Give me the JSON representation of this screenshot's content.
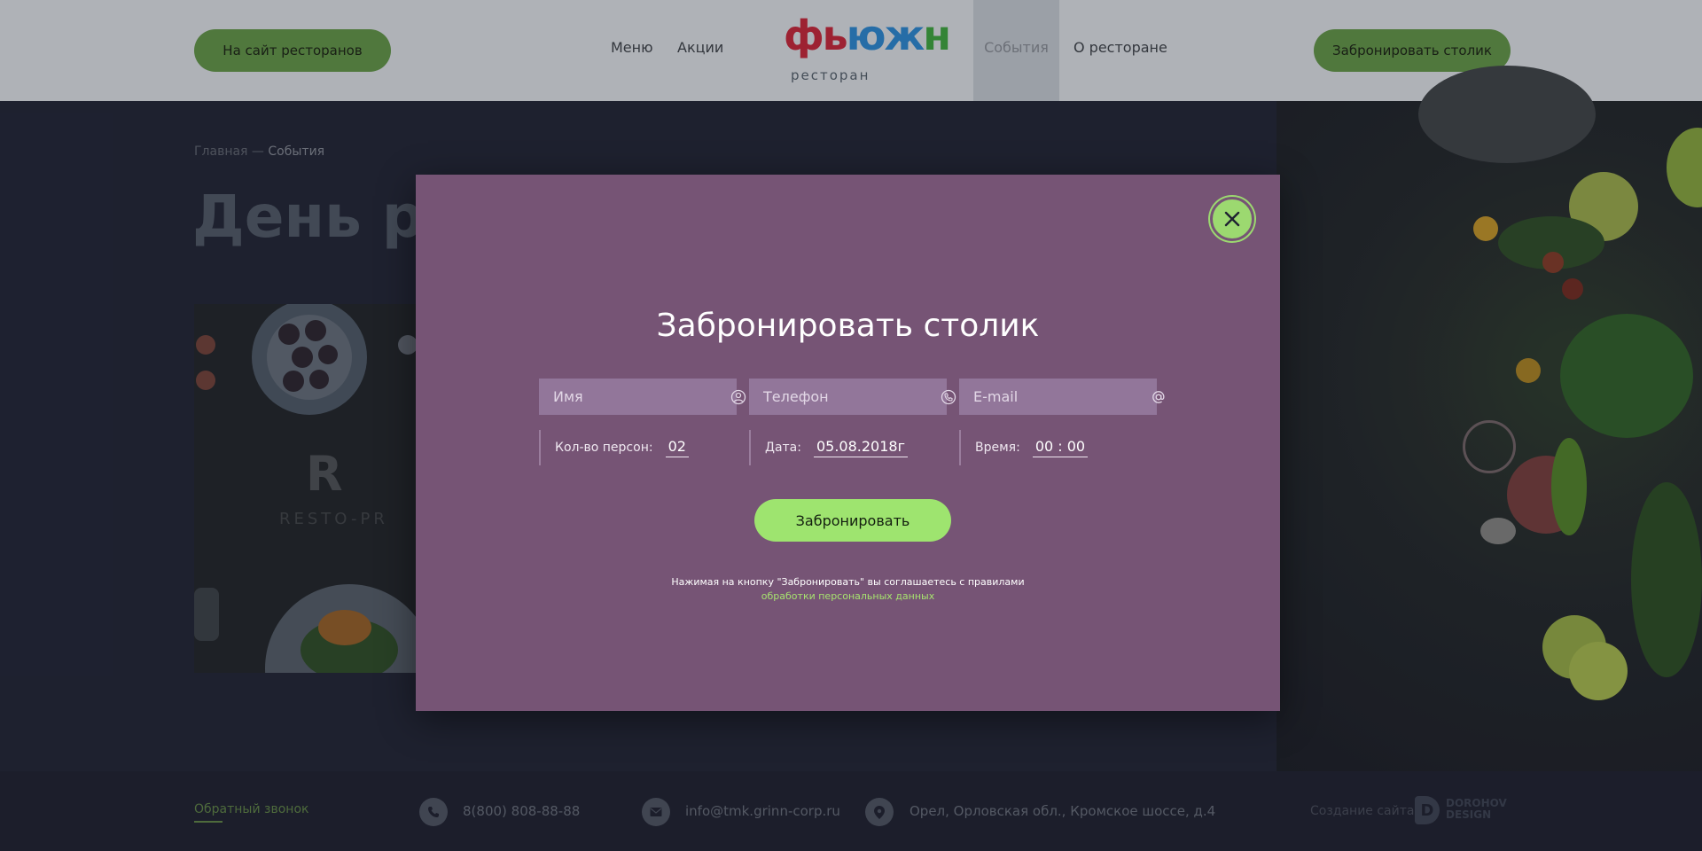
{
  "header": {
    "restaurants_link": "На сайт ресторанов",
    "nav": [
      "Меню",
      "Акции",
      "События",
      "О ресторане"
    ],
    "active_nav": "События",
    "logo_text": "фьюжн",
    "logo_subtitle": "ресторан",
    "book_button": "Забронировать столик"
  },
  "page": {
    "breadcrumb_home": "Главная",
    "breadcrumb_separator": " — ",
    "breadcrumb_current": "События",
    "title": "День рож",
    "photo_logo_letter": "R",
    "photo_logo_text": "RESTO-PR"
  },
  "modal": {
    "title": "Забронировать столик",
    "fields": {
      "name_placeholder": "Имя",
      "phone_placeholder": "Телефон",
      "email_placeholder": "E-mail"
    },
    "persons_label": "Кол-во персон:",
    "persons_value": "02",
    "date_label": "Дата:",
    "date_value": "05.08.2018г",
    "time_label": "Время:",
    "time_value": "00 : 00",
    "submit_label": "Забронировать",
    "consent_text": "Нажимая на кнопку \"Забронировать\" вы соглашаетесь с правилами",
    "consent_link": "обработки персональных данных",
    "close_icon": "close-icon"
  },
  "footer": {
    "callback": "Обратный звонок",
    "phone": "8(800) 808-88-88",
    "email": "info@tmk.grinn-corp.ru",
    "address": "Орел, Орловская обл., Кромское шоссе, д.4",
    "credit": "Создание сайта -",
    "credit_brand_line1": "DOROHOV",
    "credit_brand_line2": "DESIGN"
  },
  "colors": {
    "accent_green": "#9ee46f",
    "modal_bg": "#765475",
    "field_bg": "#92769a",
    "logo_red": "#b8263a",
    "logo_blue": "#2b7fc4",
    "logo_green": "#3c9a3e"
  }
}
